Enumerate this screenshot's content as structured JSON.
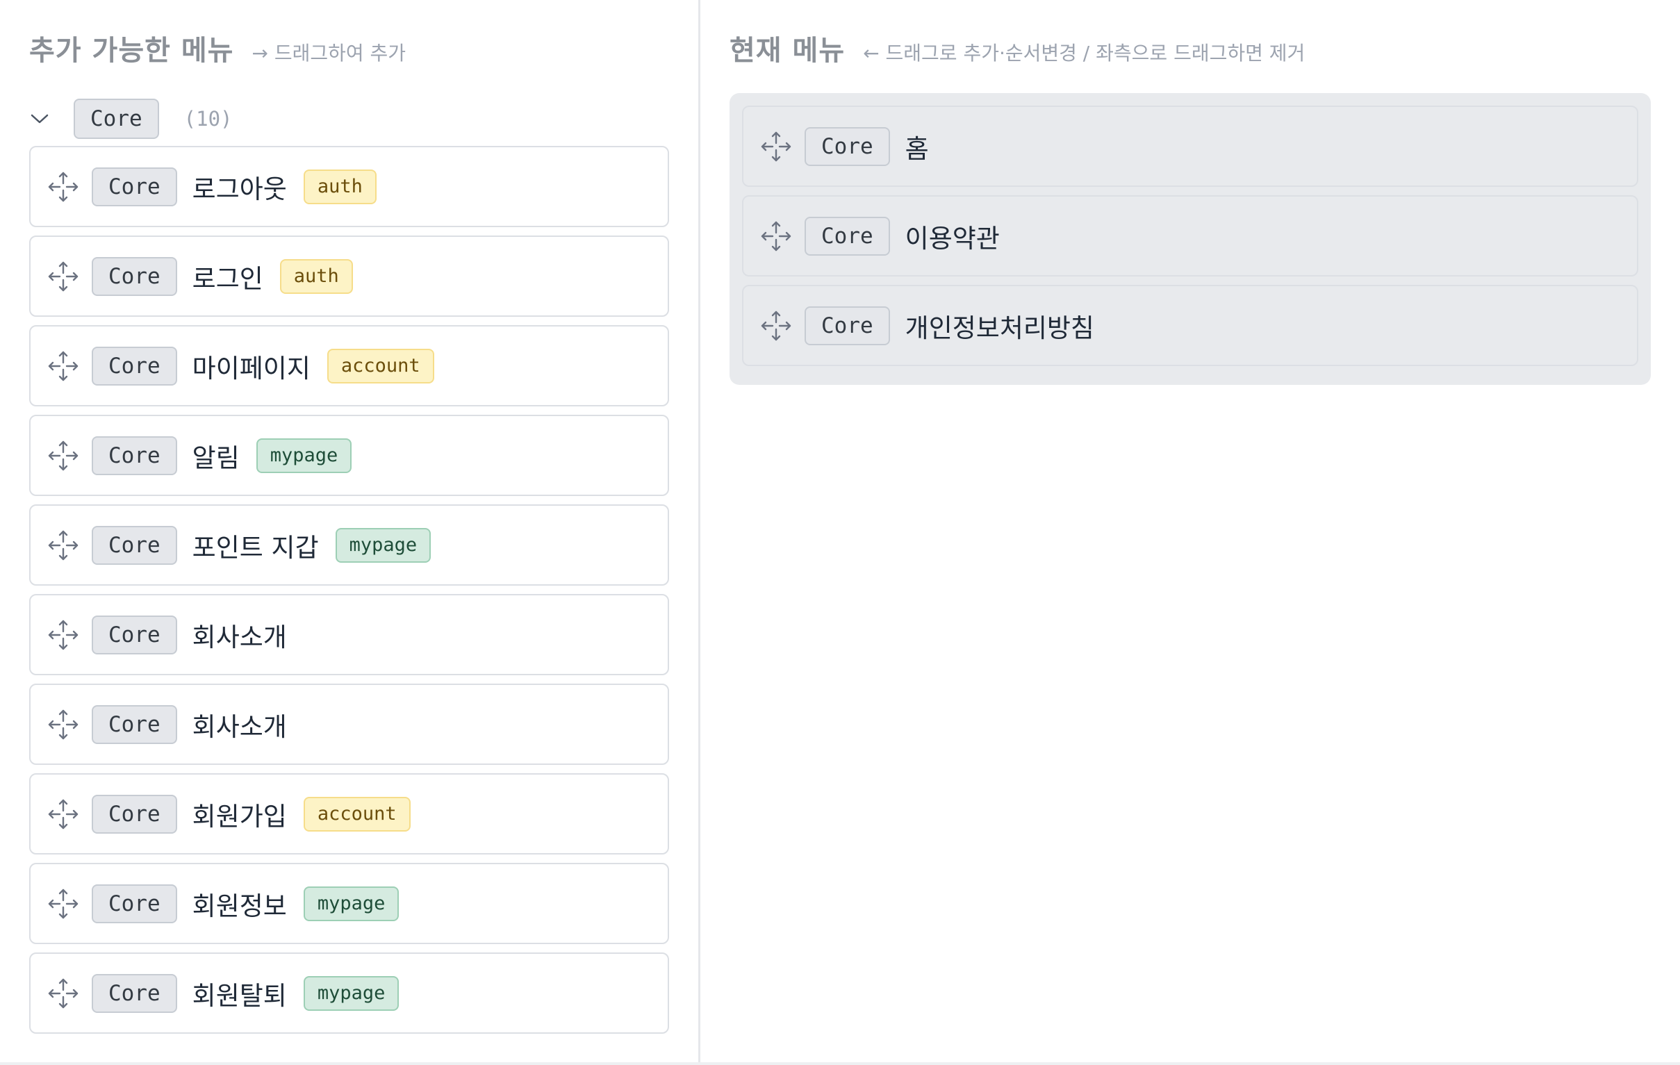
{
  "available": {
    "title": "추가 가능한 메뉴",
    "hint": "→ 드래그하여 추가",
    "group": {
      "tag": "Core",
      "count": "(10)"
    },
    "items": [
      {
        "tag": "Core",
        "label": "로그아웃",
        "badge": "auth",
        "badge_color": "yellow"
      },
      {
        "tag": "Core",
        "label": "로그인",
        "badge": "auth",
        "badge_color": "yellow"
      },
      {
        "tag": "Core",
        "label": "마이페이지",
        "badge": "account",
        "badge_color": "yellow"
      },
      {
        "tag": "Core",
        "label": "알림",
        "badge": "mypage",
        "badge_color": "green"
      },
      {
        "tag": "Core",
        "label": "포인트 지갑",
        "badge": "mypage",
        "badge_color": "green"
      },
      {
        "tag": "Core",
        "label": "회사소개",
        "badge": "",
        "badge_color": ""
      },
      {
        "tag": "Core",
        "label": "회사소개",
        "badge": "",
        "badge_color": ""
      },
      {
        "tag": "Core",
        "label": "회원가입",
        "badge": "account",
        "badge_color": "yellow"
      },
      {
        "tag": "Core",
        "label": "회원정보",
        "badge": "mypage",
        "badge_color": "green"
      },
      {
        "tag": "Core",
        "label": "회원탈퇴",
        "badge": "mypage",
        "badge_color": "green"
      }
    ]
  },
  "current": {
    "title": "현재 메뉴",
    "hint": "← 드래그로 추가·순서변경 / 좌측으로 드래그하면 제거",
    "items": [
      {
        "tag": "Core",
        "label": "홈"
      },
      {
        "tag": "Core",
        "label": "이용약관"
      },
      {
        "tag": "Core",
        "label": "개인정보처리방침"
      }
    ]
  },
  "icons": {
    "drag": "move-arrows-icon",
    "collapse": "chevron-down-icon"
  },
  "colors": {
    "badge_yellow_bg": "#fdf3c6",
    "badge_green_bg": "#d5ebe0",
    "drop_zone_bg": "#e8eaed",
    "tag_bg": "#e5e7eb"
  }
}
